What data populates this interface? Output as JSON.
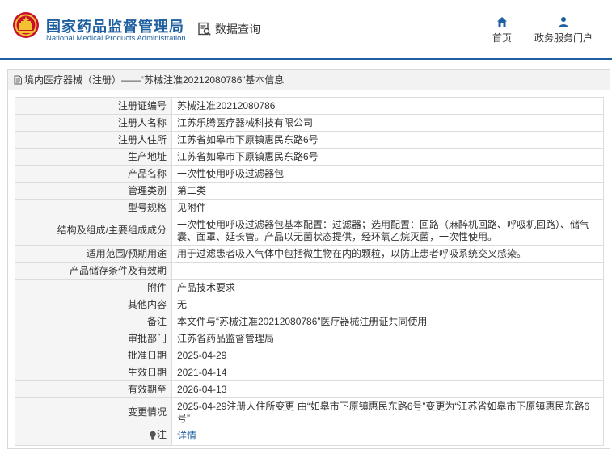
{
  "header": {
    "brand_cn": "国家药品监督管理局",
    "brand_en": "National Medical Products Administration",
    "query_label": "数据查询",
    "nav": {
      "home": "首页",
      "portal": "政务服务门户"
    },
    "accent_color": "#1d5f9f"
  },
  "panel": {
    "title": "境内医疗器械（注册）——“苏械注准20212080786”基本信息"
  },
  "rows": [
    {
      "label": "注册证编号",
      "value": "苏械注准20212080786"
    },
    {
      "label": "注册人名称",
      "value": "江苏乐腾医疗器械科技有限公司"
    },
    {
      "label": "注册人住所",
      "value": "江苏省如皋市下原镇惠民东路6号"
    },
    {
      "label": "生产地址",
      "value": "江苏省如皋市下原镇惠民东路6号"
    },
    {
      "label": "产品名称",
      "value": "一次性使用呼吸过滤器包"
    },
    {
      "label": "管理类别",
      "value": "第二类"
    },
    {
      "label": "型号规格",
      "value": "见附件"
    },
    {
      "label": "结构及组成/主要组成成分",
      "value": "一次性使用呼吸过滤器包基本配置：过滤器；选用配置：回路（麻醉机回路、呼吸机回路）、储气囊、面罩、延长管。产品以无菌状态提供，经环氧乙烷灭菌，一次性使用。"
    },
    {
      "label": "适用范围/预期用途",
      "value": "用于过滤患者吸入气体中包括微生物在内的颗粒，以防止患者呼吸系统交叉感染。"
    },
    {
      "label": "产品储存条件及有效期",
      "value": ""
    },
    {
      "label": "附件",
      "value": "产品技术要求"
    },
    {
      "label": "其他内容",
      "value": "无"
    },
    {
      "label": "备注",
      "value": "本文件与“苏械注准20212080786”医疗器械注册证共同使用"
    },
    {
      "label": "审批部门",
      "value": "江苏省药品监督管理局"
    },
    {
      "label": "批准日期",
      "value": "2025-04-29"
    },
    {
      "label": "生效日期",
      "value": "2021-04-14"
    },
    {
      "label": "有效期至",
      "value": "2026-04-13"
    },
    {
      "label": "变更情况",
      "value": "2025-04-29注册人住所变更 由“如皋市下原镇惠民东路6号”变更为“江苏省如皋市下原镇惠民东路6号”"
    }
  ],
  "note": {
    "label": "注",
    "link": "详情",
    "icon": "bulb-icon"
  }
}
